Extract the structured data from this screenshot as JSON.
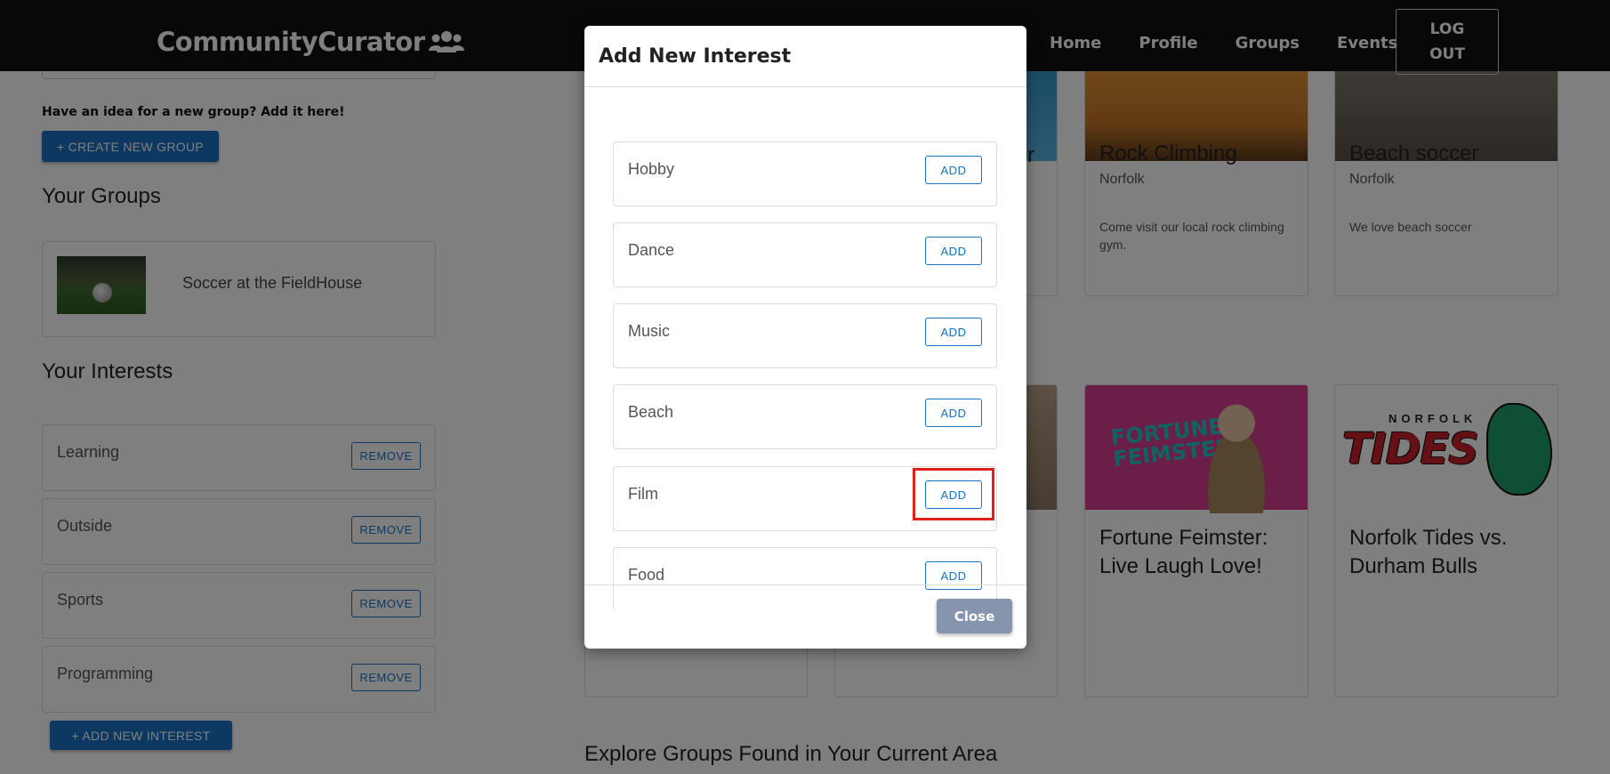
{
  "navbar": {
    "brand": "CommunityCurator",
    "links": [
      "Home",
      "Profile",
      "Groups",
      "Events"
    ],
    "logout_line1": "LOG",
    "logout_line2": "OUT"
  },
  "left": {
    "idea_text": "Have an idea for a new group? Add it here!",
    "create_group_label": "+ CREATE NEW GROUP",
    "your_groups_heading": "Your Groups",
    "groups": [
      {
        "name": "Soccer at the FieldHouse"
      }
    ],
    "your_interests_heading": "Your Interests",
    "interests": [
      {
        "label": "Learning",
        "action": "REMOVE"
      },
      {
        "label": "Outside",
        "action": "REMOVE"
      },
      {
        "label": "Sports",
        "action": "REMOVE"
      },
      {
        "label": "Programming",
        "action": "REMOVE"
      }
    ],
    "add_interest_label": "+ ADD NEW INTEREST"
  },
  "cards": {
    "partial_title_suffix": "r",
    "rock_climbing": {
      "title": "Rock Climbing",
      "location": "Norfolk",
      "description": "Come visit our local rock climbing gym."
    },
    "beach_soccer": {
      "title": "Beach soccer",
      "location": "Norfolk",
      "description": "We love beach soccer"
    },
    "fortune": {
      "title": "Fortune Feimster: Live Laugh Love!",
      "image_text": "FORTUNE FEIMSTER"
    },
    "tides": {
      "title": "Norfolk Tides vs. Durham Bulls",
      "image_small": "NORFOLK",
      "image_big": "TIDES"
    }
  },
  "explore_heading": "Explore Groups Found in Your Current Area",
  "modal": {
    "title": "Add New Interest",
    "options": [
      {
        "label": "Hobby",
        "action": "ADD"
      },
      {
        "label": "Dance",
        "action": "ADD"
      },
      {
        "label": "Music",
        "action": "ADD"
      },
      {
        "label": "Beach",
        "action": "ADD"
      },
      {
        "label": "Film",
        "action": "ADD"
      },
      {
        "label": "Food",
        "action": "ADD"
      }
    ],
    "close_label": "Close"
  },
  "colors": {
    "primary": "#1971c2",
    "navbar_bg": "#111111",
    "highlight": "#e0201c",
    "close_button": "#8694ad"
  }
}
